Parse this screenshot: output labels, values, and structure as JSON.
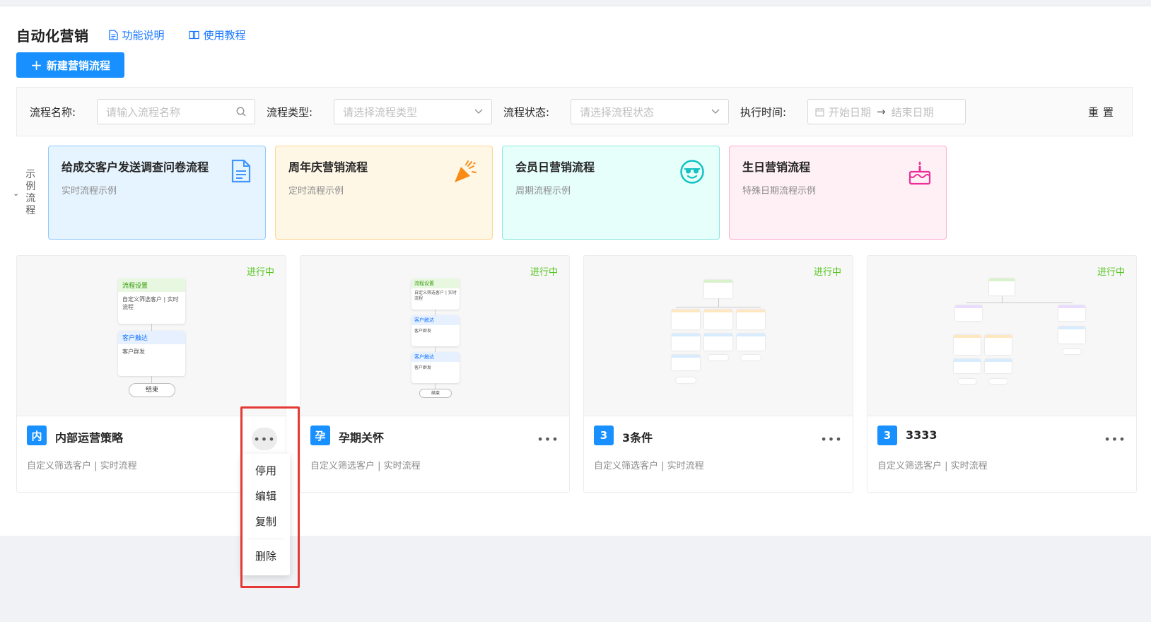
{
  "header": {
    "title": "自动化营销",
    "links": [
      {
        "label": "功能说明",
        "icon": "document-icon"
      },
      {
        "label": "使用教程",
        "icon": "book-icon"
      }
    ],
    "new_button": "新建营销流程",
    "accent": "#1890ff"
  },
  "filters": {
    "name_label": "流程名称:",
    "name_placeholder": "请输入流程名称",
    "type_label": "流程类型:",
    "type_placeholder": "请选择流程类型",
    "status_label": "流程状态:",
    "status_placeholder": "请选择流程状态",
    "time_label": "执行时间:",
    "start_placeholder": "开始日期",
    "end_placeholder": "结束日期",
    "reset": "重置"
  },
  "examples": {
    "toggle_label": "示例流程",
    "cards": [
      {
        "name": "给成交客户发送调查问卷流程",
        "desc": "实时流程示例",
        "icon": "document-icon",
        "bg": "#e6f4ff",
        "border": "#91caff",
        "icon_color": "#4096ff"
      },
      {
        "name": "周年庆营销流程",
        "desc": "定时流程示例",
        "icon": "party-popper-icon",
        "bg": "#fff7e6",
        "border": "#ffd591",
        "icon_color": "#fa8c16"
      },
      {
        "name": "会员日营销流程",
        "desc": "周期流程示例",
        "icon": "smile-sunglasses-icon",
        "bg": "#e6fffb",
        "border": "#87e8de",
        "icon_color": "#13c2c2"
      },
      {
        "name": "生日营销流程",
        "desc": "特殊日期流程示例",
        "icon": "birthday-cake-icon",
        "bg": "#fff0f6",
        "border": "#ffadd2",
        "icon_color": "#eb2f96"
      }
    ]
  },
  "flows": [
    {
      "avatar": "内",
      "name": "内部运营策略",
      "desc": "自定义筛选客户 | 实时流程",
      "status": "进行中",
      "preview": {
        "node1_title": "流程设置",
        "node1_body": "自定义筛选客户 | 实时流程",
        "node2_title": "客户触达",
        "node2_body": "客户群发",
        "end": "结束"
      }
    },
    {
      "avatar": "孕",
      "name": "孕期关怀",
      "desc": "自定义筛选客户 | 实时流程",
      "status": "进行中",
      "preview": {
        "node1_title": "流程设置",
        "node1_body": "自定义筛选客户 | 实时流程",
        "node2_title": "客户触达",
        "node2_body": "客户群发",
        "node3_title": "客户触达",
        "node3_body": "客户群发",
        "end": "结束"
      }
    },
    {
      "avatar": "3",
      "name": "3条件",
      "desc": "自定义筛选客户 | 实时流程",
      "status": "进行中"
    },
    {
      "avatar": "3",
      "name": "3333",
      "desc": "自定义筛选客户 | 实时流程",
      "status": "进行中"
    }
  ],
  "more_glyph": "•••",
  "menu": {
    "items": [
      "停用",
      "编辑",
      "复制"
    ],
    "danger_item": "删除"
  }
}
